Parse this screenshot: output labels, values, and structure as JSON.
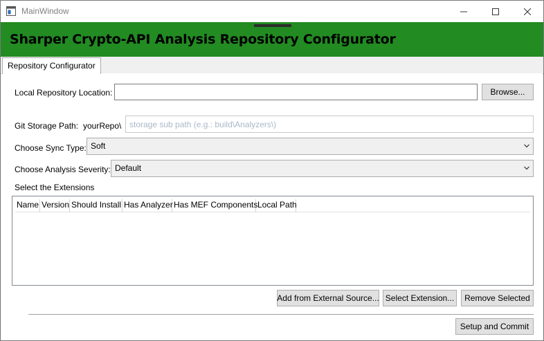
{
  "window": {
    "title": "MainWindow",
    "controls": {
      "minimize_icon": "minimize-icon",
      "maximize_icon": "maximize-icon",
      "close_icon": "close-icon"
    }
  },
  "header": {
    "title": "Sharper Crypto-API Analysis Repository Configurator",
    "background": "#228b22"
  },
  "tabs": [
    {
      "label": "Repository Configurator",
      "selected": true
    }
  ],
  "form": {
    "local_repo_label": "Local Repository Location:",
    "local_repo_value": "",
    "browse_label": "Browse...",
    "git_storage_label": "Git Storage Path:",
    "git_storage_prefix": "yourRepo\\",
    "git_storage_placeholder": "storage sub path (e.g.: build\\Analyzers\\)",
    "sync_type_label": "Choose Sync Type:",
    "sync_type_value": "Soft",
    "severity_label": "Choose Analysis Severity:",
    "severity_value": "Default",
    "extensions_label": "Select the Extensions"
  },
  "extensions_table": {
    "columns": [
      "Name",
      "Version",
      "Should Install",
      "Has Analyzer",
      "Has MEF Components",
      "Local Path"
    ],
    "rows": []
  },
  "actions": {
    "add_external_label": "Add from External Source...",
    "select_extension_label": "Select Extension...",
    "remove_selected_label": "Remove Selected",
    "setup_commit_label": "Setup and Commit"
  }
}
